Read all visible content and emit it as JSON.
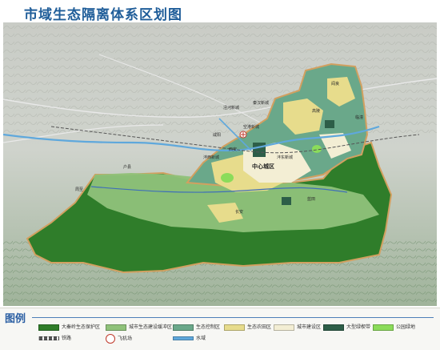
{
  "title": "市域生态隔离体系区划图",
  "map": {
    "labels": {
      "center_city": "中心城区",
      "labels_small": [
        "西安",
        "咸阳",
        "空港新城",
        "泾河新城",
        "秦汉新城",
        "沣西新城",
        "沣东新城",
        "高陵",
        "阎良",
        "临潼",
        "户县",
        "长安",
        "蓝田",
        "周至"
      ]
    },
    "colors": {
      "ecological_protection": "#2f7d2a",
      "ecological_buffer": "#8fc27a",
      "ecological_control": "#6aa88a",
      "ecological_farmland": "#e7dc8c",
      "urban_construction": "#f3eed4",
      "large_green": "#2d5e48",
      "park_green": "#8bdc5a",
      "river": "#5fa8dc",
      "boundary": "#d2a060"
    }
  },
  "legend": {
    "title": "图例",
    "items": [
      {
        "label": "大秦岭生态保护区",
        "color": "#2f7d2a"
      },
      {
        "label": "城市生态建设缓冲区",
        "color": "#8fc27a"
      },
      {
        "label": "生态控制区",
        "color": "#6aa88a"
      },
      {
        "label": "生态农田区",
        "color": "#e7dc8c"
      },
      {
        "label": "城市建设区",
        "color": "#f3eed4"
      },
      {
        "label": "大型绿楔带",
        "color": "#2d5e48"
      },
      {
        "label": "公园绿地",
        "color": "#8bdc5a"
      },
      {
        "label": "铁路"
      },
      {
        "label": "飞机场"
      },
      {
        "label": "水域"
      }
    ]
  }
}
